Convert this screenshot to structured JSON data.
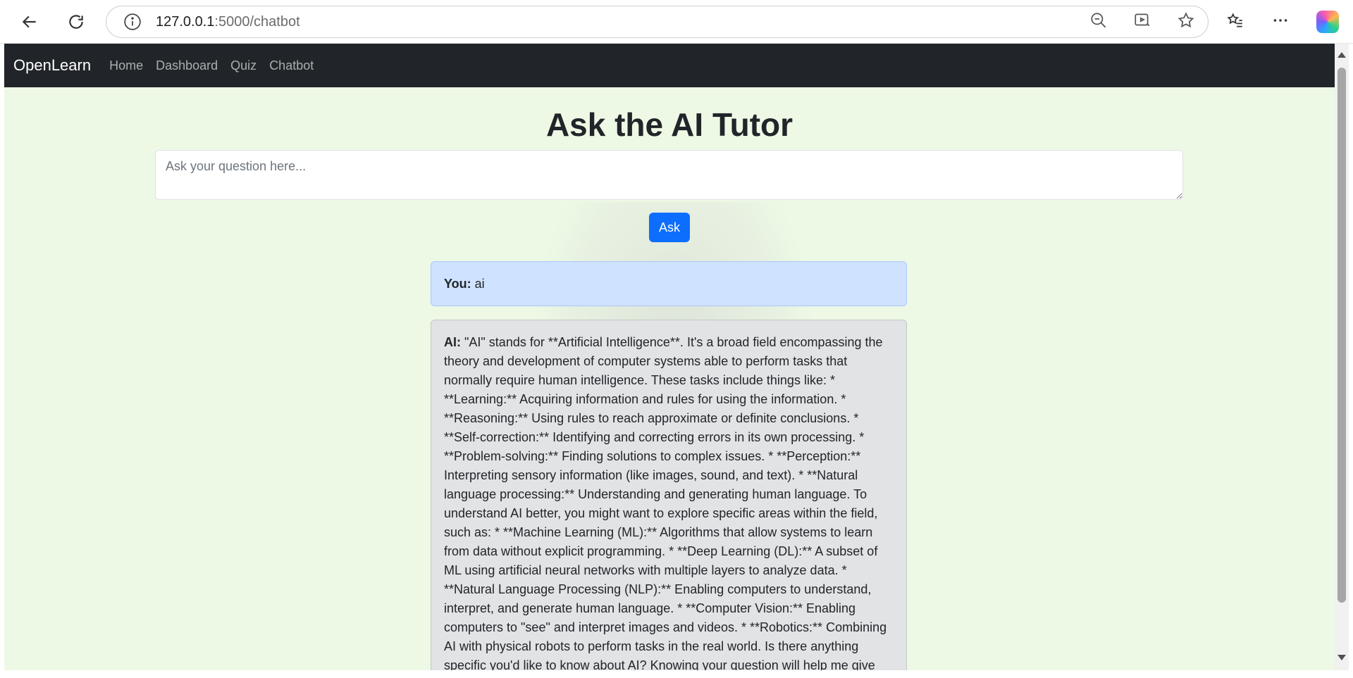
{
  "browser": {
    "url_host": "127.0.0.1",
    "url_path": ":5000/chatbot"
  },
  "navbar": {
    "brand": "OpenLearn",
    "links": [
      "Home",
      "Dashboard",
      "Quiz",
      "Chatbot"
    ]
  },
  "page": {
    "title": "Ask the AI Tutor",
    "question_placeholder": "Ask your question here...",
    "ask_label": "Ask"
  },
  "messages": {
    "user_label": "You:",
    "user_text": "ai",
    "ai_label": "AI:",
    "ai_text": "\"AI\" stands for **Artificial Intelligence**. It's a broad field encompassing the theory and development of computer systems able to perform tasks that normally require human intelligence. These tasks include things like: * **Learning:** Acquiring information and rules for using the information. * **Reasoning:** Using rules to reach approximate or definite conclusions. * **Self-correction:** Identifying and correcting errors in its own processing. * **Problem-solving:** Finding solutions to complex issues. * **Perception:** Interpreting sensory information (like images, sound, and text). * **Natural language processing:** Understanding and generating human language. To understand AI better, you might want to explore specific areas within the field, such as: * **Machine Learning (ML):** Algorithms that allow systems to learn from data without explicit programming. * **Deep Learning (DL):** A subset of ML using artificial neural networks with multiple layers to analyze data. * **Natural Language Processing (NLP):** Enabling computers to understand, interpret, and generate human language. * **Computer Vision:** Enabling computers to \"see\" and interpret images and videos. * **Robotics:** Combining AI with physical robots to perform tasks in the real world. Is there anything specific you'd like to know about AI? Knowing your question will help me give"
  },
  "colors": {
    "navbar_bg": "#212529",
    "page_bg": "#edf9e5",
    "primary": "#0d6efd",
    "user_msg_bg": "#cfe2ff",
    "ai_msg_bg": "#e2e3e5"
  }
}
